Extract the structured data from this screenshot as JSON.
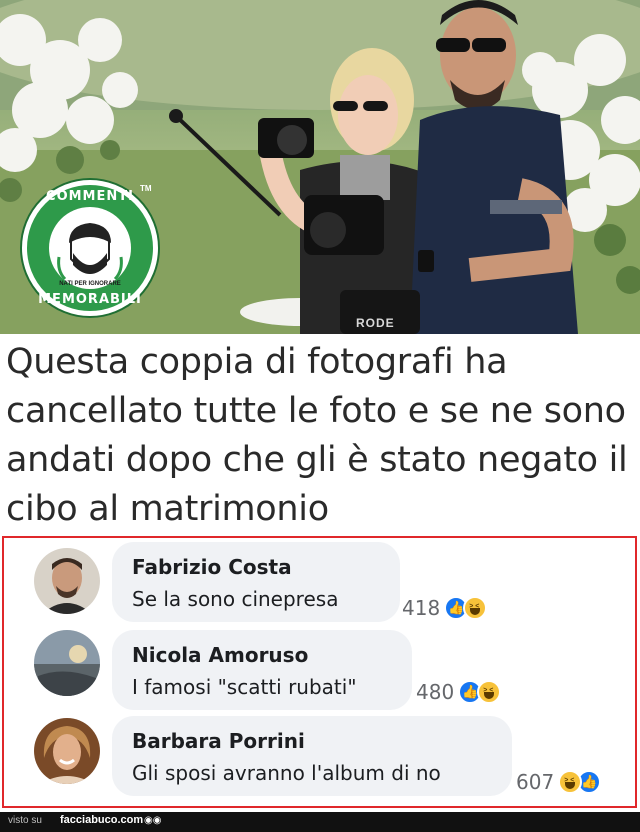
{
  "badge": {
    "top_text": "COMMENTI",
    "bottom_text": "MEMORABILI",
    "sub_text": "NATI PER IGNORARE",
    "tm": "TM"
  },
  "photo": {
    "mic_brand": "RODE"
  },
  "caption": "Questa coppia di fotografi ha cancellato tutte le foto e se ne sono andati dopo che gli è stato negato il cibo al matrimonio",
  "comments": [
    {
      "name": "Fabrizio Costa",
      "text": "Se la sono cinepresa",
      "count": "418",
      "reactions": [
        "like-reaction-icon",
        "haha-reaction-icon"
      ]
    },
    {
      "name": "Nicola Amoruso",
      "text": "I famosi \"scatti rubati\"",
      "count": "480",
      "reactions": [
        "like-reaction-icon",
        "haha-reaction-icon"
      ]
    },
    {
      "name": "Barbara Porrini",
      "text": "Gli sposi avranno l'album di no",
      "count": "607",
      "reactions": [
        "haha-reaction-icon",
        "like-reaction-icon"
      ]
    }
  ],
  "footer": {
    "visto_su": "visto su",
    "site": "facciabuco.com",
    "logo_glyph": "◉◉"
  },
  "colors": {
    "badge_green": "#2e9a4a",
    "frame_red": "#e0282b",
    "bubble_gray": "#f0f2f5",
    "like_blue": "#1877f2",
    "haha_yellow": "#f7c23a"
  }
}
